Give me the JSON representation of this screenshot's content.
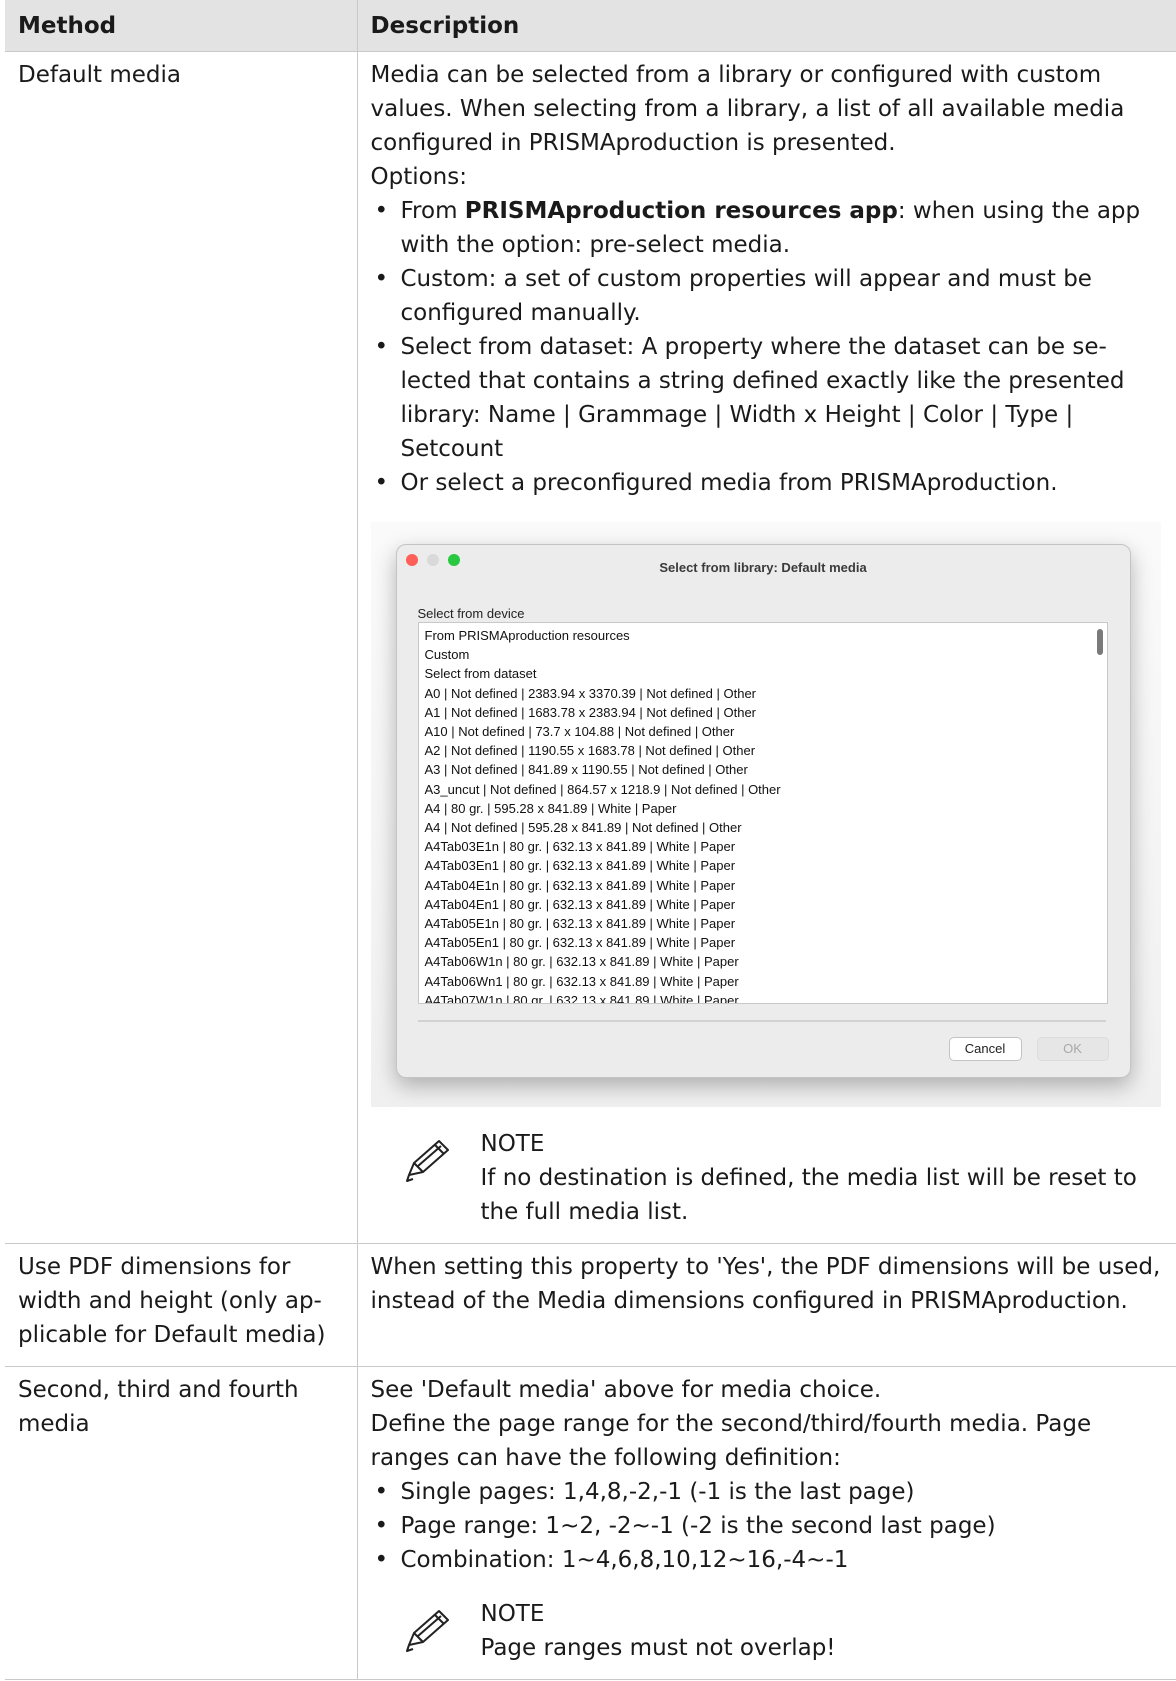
{
  "table": {
    "headers": {
      "method": "Method",
      "description": "Description"
    },
    "row1": {
      "method": "Default media",
      "intro": "Media can be selected from a library or configured with custom values. When selecting from a library, a list of all available media configured in PRISMAproduction is presented.",
      "options_label": "Options:",
      "b1_pre": "From ",
      "b1_bold": "PRISMAproduction resources app",
      "b1_post": ": when using the app with the option: pre-select media.",
      "b2": "Custom: a set of custom properties will appear and must be configured manually.",
      "b3": "Select from dataset: A property where the dataset can be se­lected that contains a string defined exactly like the presented library: Name | Grammage | Width x Height | Color | Type | Setcount",
      "b4": "Or select a preconfigured media from PRISMAproduction.",
      "note_title": "NOTE",
      "note_text": "If no destination is defined, the media list will be reset to the full media list."
    },
    "row2": {
      "method": "Use PDF dimensions for width and height (only ap­plicable for Default media)",
      "description": "When setting this property to 'Yes', the PDF dimensions will be used, instead of the Media dimensions configured in PRISMAproduction."
    },
    "row3": {
      "method": "Second, third and fourth media",
      "line1": "See 'Default media' above for media choice.",
      "line2": "Define the page range for the second/third/fourth media. Page ranges can have the following definition:",
      "b1": "Single pages: 1,4,8,-2,-1 (-1 is the last page)",
      "b2": "Page range: 1~2, -2~-1 (-2 is the second last page)",
      "b3": "Combination: 1~4,6,8,10,12~16,-4~-1",
      "note_title": "NOTE",
      "note_text": "Page ranges must not overlap!"
    }
  },
  "dialog": {
    "title": "Select from library: Default media",
    "label": "Select from device",
    "items": [
      "From PRISMAproduction resources",
      "Custom",
      "Select from dataset",
      "A0 | Not defined | 2383.94 x 3370.39 | Not defined | Other",
      "A1 | Not defined | 1683.78 x 2383.94 | Not defined | Other",
      "A10 | Not defined | 73.7 x 104.88 | Not defined | Other",
      "A2 | Not defined | 1190.55 x 1683.78 | Not defined | Other",
      "A3 | Not defined | 841.89 x 1190.55 | Not defined | Other",
      "A3_uncut | Not defined | 864.57 x 1218.9 | Not defined | Other",
      "A4 | 80 gr. | 595.28 x 841.89 | White | Paper",
      "A4 | Not defined | 595.28 x 841.89 | Not defined | Other",
      "A4Tab03E1n | 80 gr. | 632.13 x 841.89 | White | Paper",
      "A4Tab03En1 | 80 gr. | 632.13 x 841.89 | White | Paper",
      "A4Tab04E1n | 80 gr. | 632.13 x 841.89 | White | Paper",
      "A4Tab04En1 | 80 gr. | 632.13 x 841.89 | White | Paper",
      "A4Tab05E1n | 80 gr. | 632.13 x 841.89 | White | Paper",
      "A4Tab05En1 | 80 gr. | 632.13 x 841.89 | White | Paper",
      "A4Tab06W1n | 80 gr. | 632.13 x 841.89 | White | Paper",
      "A4Tab06Wn1 | 80 gr. | 632.13 x 841.89 | White | Paper",
      "A4Tab07W1n | 80 gr. | 632.13 x 841.89 | White | Paper"
    ],
    "cancel_label": "Cancel",
    "ok_label": "OK"
  },
  "icons": {
    "note": "pencil-icon"
  }
}
